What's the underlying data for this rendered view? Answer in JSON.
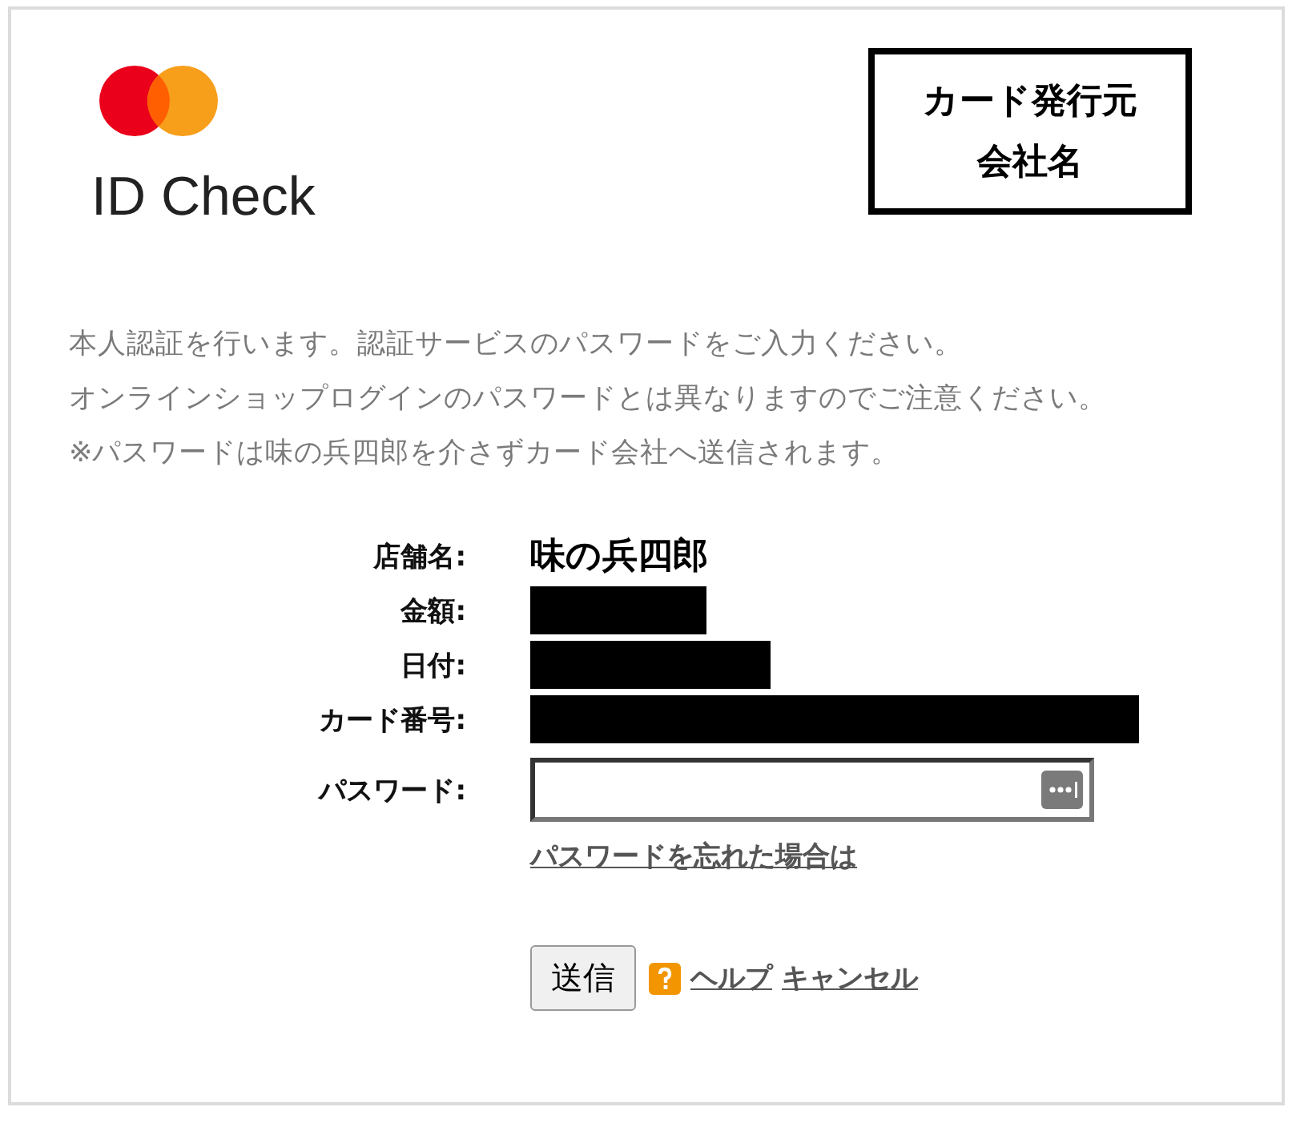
{
  "brand": {
    "name": "ID Check"
  },
  "issuer": {
    "lines": [
      "カード発行元",
      "会社名"
    ]
  },
  "intro": [
    "本人認証を行います。認証サービスのパスワードをご入力ください。",
    "オンラインショップログインのパスワードとは異なりますのでご注意ください。",
    "※パスワードは味の兵四郎を介さずカード会社へ送信されます。"
  ],
  "details": [
    {
      "label": "店舗名:",
      "kind": "text",
      "value": "味の兵四郎"
    },
    {
      "label": "金額:",
      "kind": "redacted"
    },
    {
      "label": "日付:",
      "kind": "redacted"
    },
    {
      "label": "カード番号:",
      "kind": "redacted"
    }
  ],
  "password": {
    "label": "パスワード:"
  },
  "forgot_link": "パスワードを忘れた場合は",
  "submit_button": "送信",
  "help_link": "ヘルプ",
  "cancel_link": "キャンセル"
}
